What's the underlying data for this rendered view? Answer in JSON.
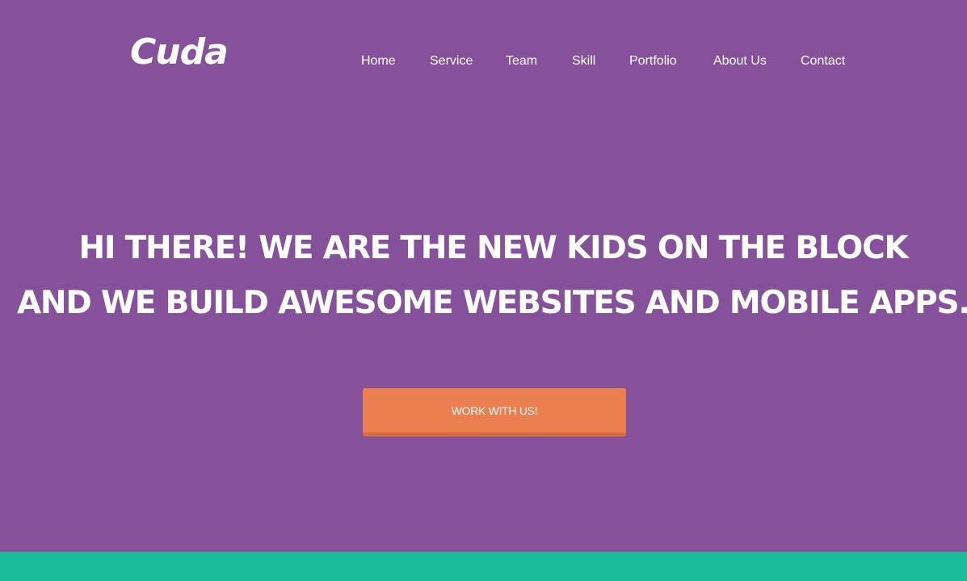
{
  "brand": {
    "logo_text": "Cuda"
  },
  "nav": {
    "items": [
      {
        "label": "Home"
      },
      {
        "label": "Service"
      },
      {
        "label": "Team"
      },
      {
        "label": "Skill"
      },
      {
        "label": "Portfolio"
      },
      {
        "label": "About Us"
      },
      {
        "label": "Contact"
      }
    ]
  },
  "hero": {
    "headline_line1": "HI THERE! WE ARE THE NEW KIDS ON THE BLOCK",
    "headline_line2": "AND WE BUILD AWESOME WEBSITES AND MOBILE APPS.",
    "cta_label": "WORK WITH US!"
  },
  "colors": {
    "hero_background": "#86519b",
    "accent_band": "#1abc9c",
    "cta_background": "#eb7f50",
    "cta_border": "#d66b3f",
    "text": "#ffffff"
  }
}
